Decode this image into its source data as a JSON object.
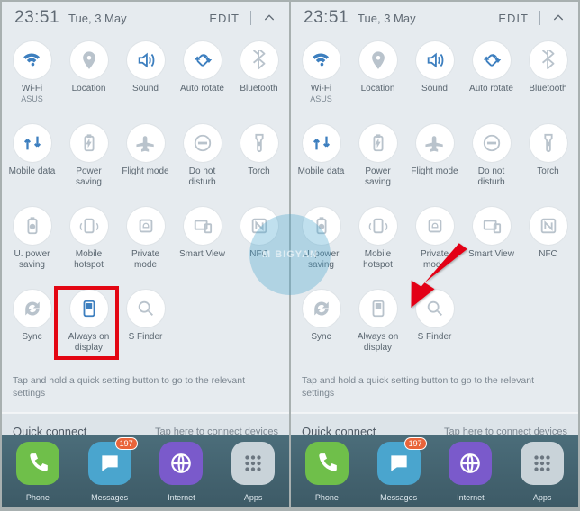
{
  "status": {
    "time": "23:51",
    "date": "Tue, 3 May",
    "edit": "EDIT"
  },
  "toggles": [
    {
      "id": "wifi",
      "label": "Wi-Fi",
      "sub": "ASUS",
      "on": true,
      "icon": "wifi"
    },
    {
      "id": "loc",
      "label": "Location",
      "sub": "",
      "on": false,
      "icon": "pin"
    },
    {
      "id": "sound",
      "label": "Sound",
      "sub": "",
      "on": true,
      "icon": "sound"
    },
    {
      "id": "rotate",
      "label": "Auto rotate",
      "sub": "",
      "on": true,
      "icon": "rotate"
    },
    {
      "id": "bt",
      "label": "Bluetooth",
      "sub": "",
      "on": false,
      "icon": "bt"
    },
    {
      "id": "mdata",
      "label": "Mobile data",
      "sub": "",
      "on": true,
      "icon": "data"
    },
    {
      "id": "psave",
      "label": "Power saving",
      "sub": "",
      "on": false,
      "icon": "bat"
    },
    {
      "id": "flight",
      "label": "Flight mode",
      "sub": "",
      "on": false,
      "icon": "plane"
    },
    {
      "id": "dnd",
      "label": "Do not disturb",
      "sub": "",
      "on": false,
      "icon": "dnd"
    },
    {
      "id": "torch",
      "label": "Torch",
      "sub": "",
      "on": false,
      "icon": "torch"
    },
    {
      "id": "upsave",
      "label": "U. power saving",
      "sub": "",
      "on": false,
      "icon": "ubat"
    },
    {
      "id": "hotspot",
      "label": "Mobile hotspot",
      "sub": "",
      "on": false,
      "icon": "hot"
    },
    {
      "id": "private",
      "label": "Private mode",
      "sub": "",
      "on": false,
      "icon": "priv"
    },
    {
      "id": "sview",
      "label": "Smart View",
      "sub": "",
      "on": false,
      "icon": "sv"
    },
    {
      "id": "nfc",
      "label": "NFC",
      "sub": "",
      "on": false,
      "icon": "nfc"
    },
    {
      "id": "sync",
      "label": "Sync",
      "sub": "",
      "on": false,
      "icon": "sync"
    },
    {
      "id": "aod",
      "label": "Always on display",
      "sub": "",
      "on": true,
      "icon": "aod"
    },
    {
      "id": "sfinder",
      "label": "S Finder",
      "sub": "",
      "on": false,
      "icon": "mag"
    }
  ],
  "hint": "Tap and hold a quick setting button to go to the relevant settings",
  "quickconnect": {
    "title": "Quick connect",
    "sub": "Tap here to connect devices"
  },
  "dock": [
    {
      "id": "phone",
      "label": "Phone",
      "badge": "",
      "color": "#6fbf4a"
    },
    {
      "id": "messages",
      "label": "Messages",
      "badge": "197",
      "color": "#4aa5ce"
    },
    {
      "id": "internet",
      "label": "Internet",
      "badge": "",
      "color": "#7a5acb"
    },
    {
      "id": "apps",
      "label": "Apps",
      "badge": "",
      "color": "#c9d3d9"
    }
  ],
  "watermark": "M   BIGYAN",
  "right_aod_on": false
}
